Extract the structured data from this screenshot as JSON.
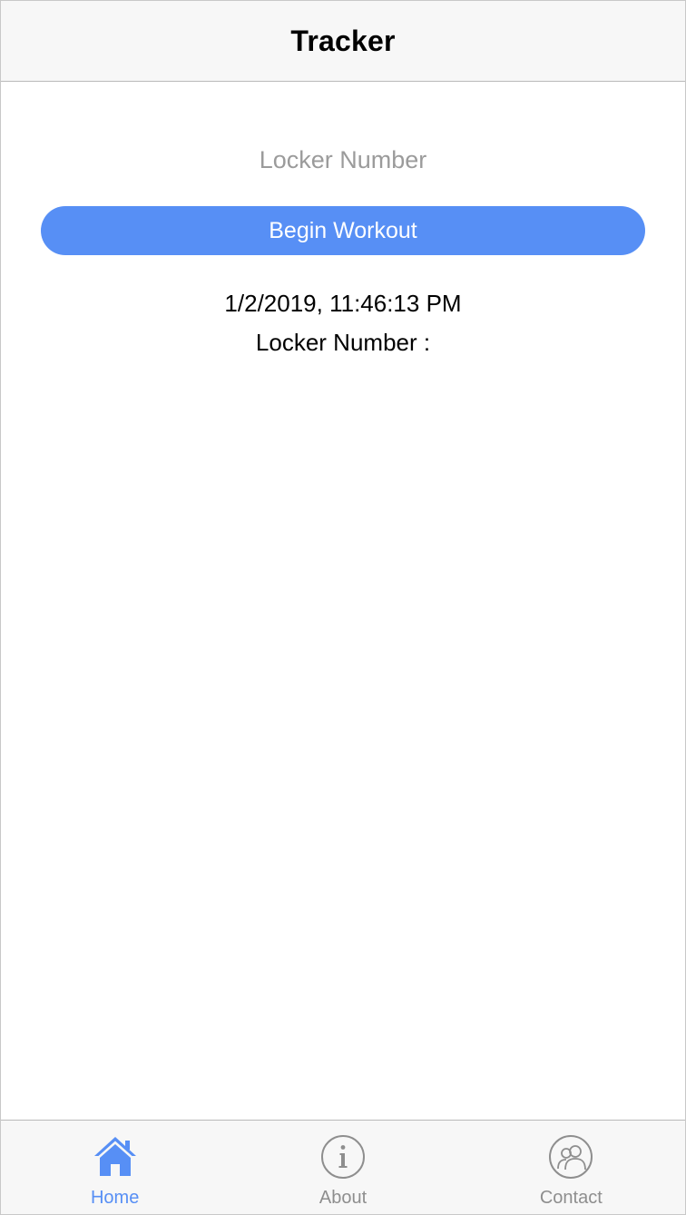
{
  "header": {
    "title": "Tracker"
  },
  "form": {
    "locker_placeholder": "Locker Number",
    "locker_value": "",
    "begin_label": "Begin Workout"
  },
  "info": {
    "timestamp": "1/2/2019, 11:46:13 PM",
    "locker_line": "Locker Number :"
  },
  "tabs": [
    {
      "label": "Home",
      "icon": "home-icon",
      "active": true
    },
    {
      "label": "About",
      "icon": "info-icon",
      "active": false
    },
    {
      "label": "Contact",
      "icon": "contact-icon",
      "active": false
    }
  ],
  "colors": {
    "accent": "#578ff5",
    "inactive": "#8e8e8e",
    "bar_background": "#f7f7f7"
  }
}
